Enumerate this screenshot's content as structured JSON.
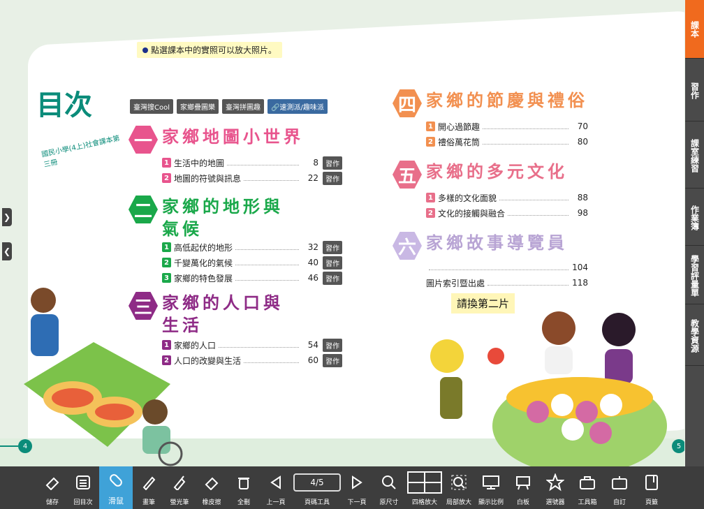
{
  "tip": "點選課本中的實照可以放大照片。",
  "contents_title": "目次",
  "book_subtitle": "國民小學(4上)社會課本第三冊",
  "tags": [
    "臺灣搜Cool",
    "家鄉疊圖樂",
    "臺灣拼圖趣",
    "速測派/趣味派"
  ],
  "work_label": "習作",
  "units": [
    {
      "num": "一",
      "title": "家鄉地圖小世界",
      "lessons": [
        {
          "n": "1",
          "name": "生活中的地圖",
          "page": "8"
        },
        {
          "n": "2",
          "name": "地圖的符號與訊息",
          "page": "22"
        }
      ]
    },
    {
      "num": "二",
      "title": "家鄉的地形與氣候",
      "lessons": [
        {
          "n": "1",
          "name": "高低起伏的地形",
          "page": "32"
        },
        {
          "n": "2",
          "name": "千變萬化的氣候",
          "page": "40"
        },
        {
          "n": "3",
          "name": "家鄉的特色發展",
          "page": "46"
        }
      ]
    },
    {
      "num": "三",
      "title": "家鄉的人口與生活",
      "lessons": [
        {
          "n": "1",
          "name": "家鄉的人口",
          "page": "54"
        },
        {
          "n": "2",
          "name": "人口的改變與生活",
          "page": "60"
        }
      ]
    },
    {
      "num": "四",
      "title": "家鄉的節慶與禮俗",
      "lessons": [
        {
          "n": "1",
          "name": "開心過節趣",
          "page": "70"
        },
        {
          "n": "2",
          "name": "禮俗萬花筒",
          "page": "80"
        }
      ]
    },
    {
      "num": "五",
      "title": "家鄉的多元文化",
      "lessons": [
        {
          "n": "1",
          "name": "多樣的文化面貌",
          "page": "88"
        },
        {
          "n": "2",
          "name": "文化的接觸與融合",
          "page": "98"
        }
      ]
    },
    {
      "num": "六",
      "title": "家鄉故事導覽員",
      "page": "104"
    }
  ],
  "index_label": "圖片索引暨出處",
  "index_page": "118",
  "swap_label": "請換第二片",
  "page_left": "4",
  "page_right": "5",
  "sidebar_tabs": [
    "課本",
    "習作",
    "課室練習",
    "作業簿",
    "學習評量單",
    "教學資源"
  ],
  "page_indicator": "4/5",
  "toolbar": [
    "儲存",
    "回目次",
    "滑鼠",
    "畫筆",
    "螢光筆",
    "橡皮擦",
    "全刪",
    "上一頁",
    "頁碼工具",
    "下一頁",
    "原尺寸",
    "四格放大",
    "局部放大",
    "顯示比例",
    "白板",
    "選號器",
    "工具箱",
    "自訂",
    "頁籤"
  ],
  "colors": {
    "accent": "#f06a1e",
    "toolbar": "#3d3d3d",
    "active_tool": "#3fa2d8",
    "teal": "#0b8c7a"
  }
}
